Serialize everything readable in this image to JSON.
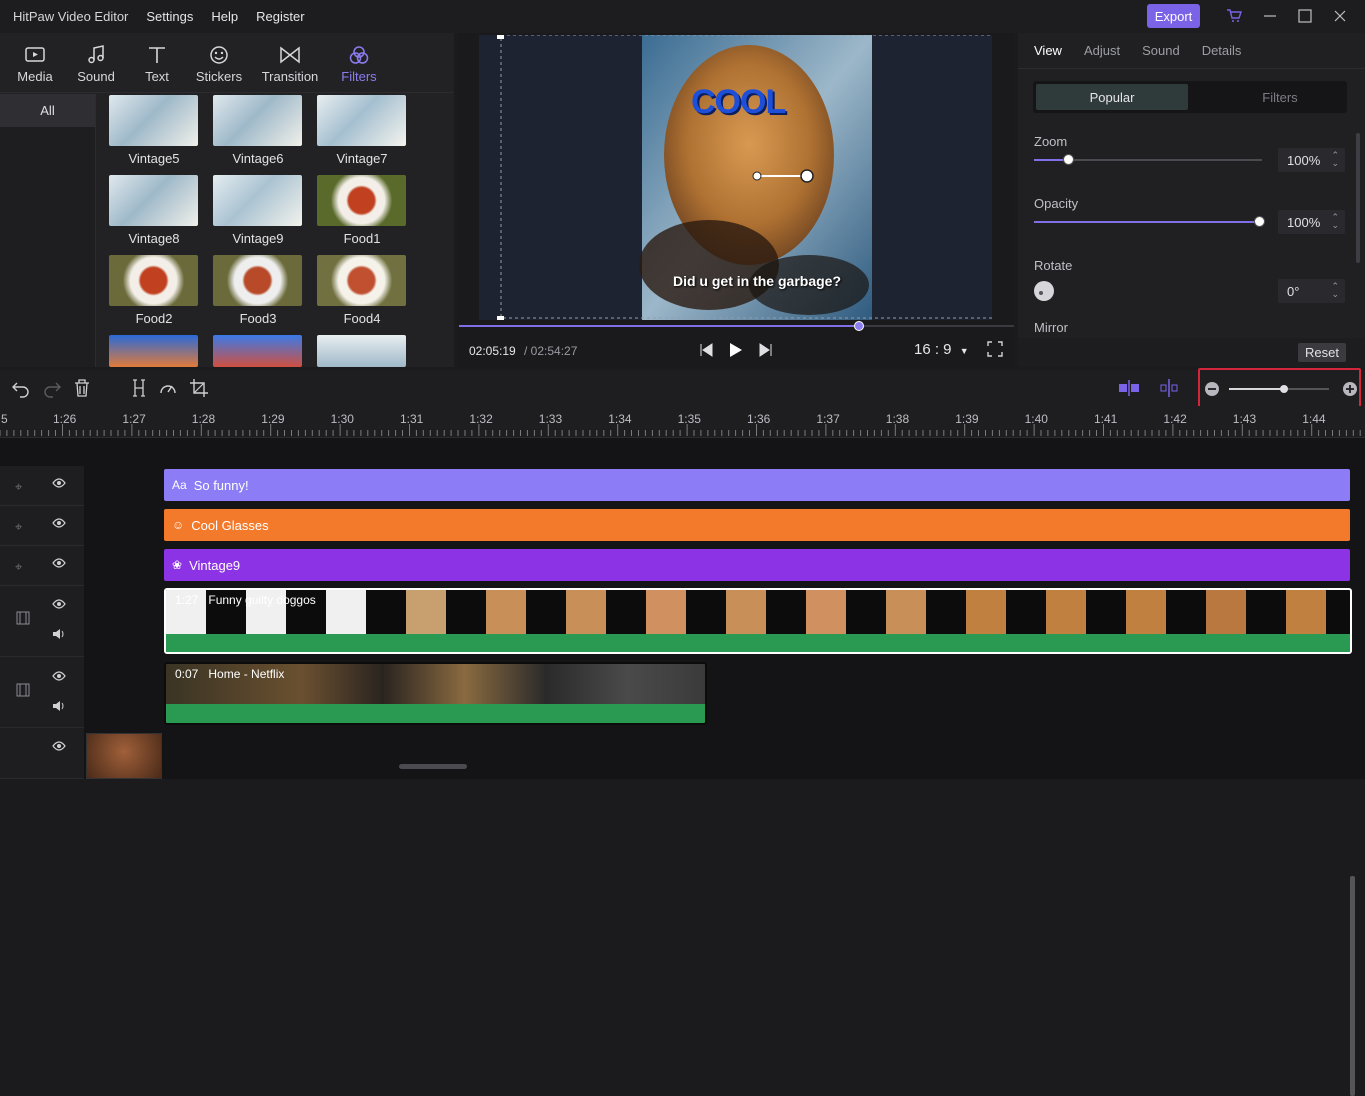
{
  "titlebar": {
    "app_title": "HitPaw Video Editor",
    "menu": [
      "Settings",
      "Help",
      "Register"
    ],
    "export_label": "Export"
  },
  "media_tabs": [
    {
      "label": "Media",
      "icon": "media-icon"
    },
    {
      "label": "Sound",
      "icon": "music-note-icon"
    },
    {
      "label": "Text",
      "icon": "text-icon"
    },
    {
      "label": "Stickers",
      "icon": "sticker-smile-icon"
    },
    {
      "label": "Transition",
      "icon": "transition-icon"
    },
    {
      "label": "Filters",
      "icon": "filters-icon",
      "active": true
    }
  ],
  "category": {
    "all_label": "All"
  },
  "filters": [
    {
      "label": "Vintage5"
    },
    {
      "label": "Vintage6"
    },
    {
      "label": "Vintage7"
    },
    {
      "label": "Vintage8"
    },
    {
      "label": "Vintage9"
    },
    {
      "label": "Food1"
    },
    {
      "label": "Food2"
    },
    {
      "label": "Food3"
    },
    {
      "label": "Food4"
    }
  ],
  "preview": {
    "sticker_text": "COOL",
    "caption": "Did u get in the garbage?",
    "current_time": "02:05:19",
    "total_time": "/ 02:54:27",
    "aspect": "16 : 9",
    "progress": 0.72
  },
  "right_panel": {
    "tabs": [
      "View",
      "Adjust",
      "Sound",
      "Details"
    ],
    "active_tab": "View",
    "segment": {
      "a": "Popular",
      "b": "Filters"
    },
    "zoom": {
      "label": "Zoom",
      "value": "100%",
      "level": 0.15
    },
    "opacity": {
      "label": "Opacity",
      "value": "100%",
      "level": 1.0
    },
    "rotate": {
      "label": "Rotate",
      "value": "0°"
    },
    "mirror": {
      "label": "Mirror"
    },
    "reset_label": "Reset"
  },
  "timeline_zoom": {
    "level": 0.55
  },
  "ruler": [
    "5",
    "1:26",
    "1:27",
    "1:28",
    "1:29",
    "1:30",
    "1:31",
    "1:32",
    "1:33",
    "1:34",
    "1:35",
    "1:36",
    "1:37",
    "1:38",
    "1:39",
    "1:40",
    "1:41",
    "1:42",
    "1:43",
    "1:44"
  ],
  "tracks": {
    "text_clip": "So funny!",
    "sticker_clip": "Cool Glasses",
    "filter_clip": "Vintage9",
    "video1": {
      "time": "1:27",
      "name": "Funny guilty doggos"
    },
    "video2": {
      "time": "0:07",
      "name": "Home - Netflix"
    }
  },
  "colors": {
    "accent": "#7a63e6",
    "text_clip": "#8c7cf5",
    "sticker_clip": "#f37a2b",
    "filter_clip": "#8d33e6",
    "audio_wave": "#2a9a53",
    "zoom_highlight": "#d3263b"
  }
}
